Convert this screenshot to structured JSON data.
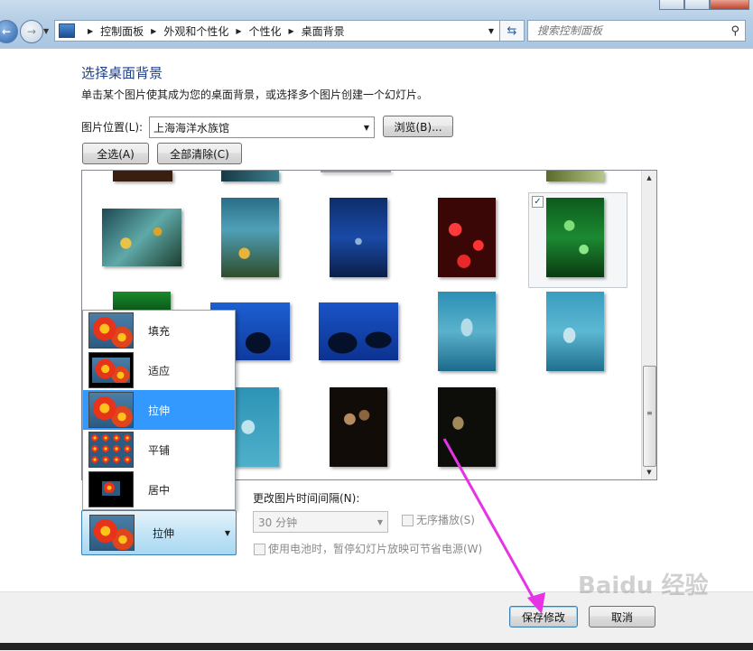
{
  "address_bar": {
    "breadcrumbs": [
      "控制面板",
      "外观和个性化",
      "个性化",
      "桌面背景"
    ]
  },
  "search": {
    "placeholder": "搜索控制面板"
  },
  "page": {
    "title": "选择桌面背景",
    "description": "单击某个图片使其成为您的桌面背景，或选择多个图片创建一个幻灯片。"
  },
  "picture_location": {
    "label": "图片位置(L):",
    "value": "上海海洋水族馆",
    "browse_label": "浏览(B)..."
  },
  "selection": {
    "select_all_label": "全选(A)",
    "clear_all_label": "全部清除(C)"
  },
  "picture_position": {
    "options": [
      "填充",
      "适应",
      "拉伸",
      "平铺",
      "居中"
    ],
    "highlighted_option": "拉伸",
    "selected": "拉伸"
  },
  "slideshow": {
    "interval_label": "更改图片时间间隔(N):",
    "interval_value": "30 分钟",
    "shuffle_label": "无序播放(S)",
    "battery_label": "使用电池时，暂停幻灯片放映可节省电源(W)"
  },
  "footer": {
    "save_label": "保存修改",
    "cancel_label": "取消"
  },
  "watermark": "Baidu 经验",
  "colors": {
    "accent_highlight": "#3399ff",
    "title_blue": "#1e3f8c",
    "annotation_arrow": "#e633e6"
  }
}
